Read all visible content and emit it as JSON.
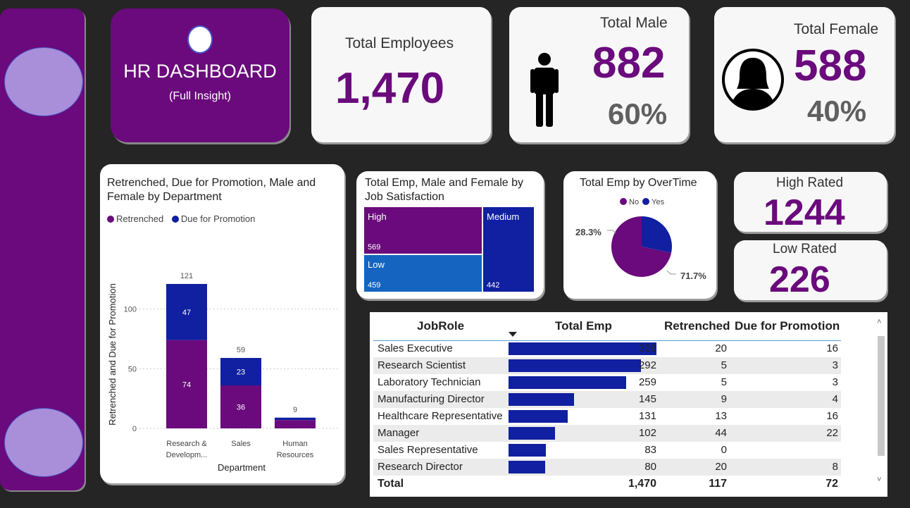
{
  "dashboard": {
    "title": "HR DASHBOARD",
    "subtitle": "(Full Insight)"
  },
  "kpi": {
    "total_employees": {
      "label": "Total Employees",
      "value": "1,470"
    },
    "total_male": {
      "label": "Total Male",
      "value": "882",
      "percent": "60%"
    },
    "total_female": {
      "label": "Total Female",
      "value": "588",
      "percent": "40%"
    },
    "high_rated": {
      "label": "High Rated",
      "value": "1244"
    },
    "low_rated": {
      "label": "Low Rated",
      "value": "226"
    }
  },
  "colors": {
    "purple": "#6a0a7c",
    "navy": "#1020a0",
    "blue": "#1565c0",
    "background": "#252525"
  },
  "chart_data": [
    {
      "type": "bar",
      "stacked": true,
      "title": "Retrenched, Due for Promotion, Male and Female by Department",
      "xlabel": "Department",
      "ylabel": "Retrenched and Due for Promotion",
      "categories": [
        "Research & Developm...",
        "Sales",
        "Human Resources"
      ],
      "series": [
        {
          "name": "Retrenched",
          "values": [
            74,
            36,
            7
          ],
          "color": "#6a0a7c"
        },
        {
          "name": "Due for Promotion",
          "values": [
            47,
            23,
            2
          ],
          "color": "#1020a0"
        }
      ],
      "totals": [
        "121",
        "59",
        "9"
      ],
      "segment_labels": {
        "retrenched": [
          "74",
          "36",
          ""
        ],
        "promotion": [
          "47",
          "23",
          ""
        ]
      },
      "yticks": [
        "0",
        "50",
        "100"
      ],
      "ylim": [
        0,
        121
      ],
      "legend": "top-left"
    },
    {
      "type": "treemap",
      "title": "Total Emp, Male and Female by Job Satisfaction",
      "items": [
        {
          "name": "High",
          "value": "569",
          "color": "#6a0a7c"
        },
        {
          "name": "Medium",
          "value": "442",
          "color": "#1020a0"
        },
        {
          "name": "Low",
          "value": "459",
          "color": "#1565c0"
        }
      ]
    },
    {
      "type": "pie",
      "title": "Total Emp by OverTime",
      "legend": "top",
      "slices": [
        {
          "name": "No",
          "value": 71.7,
          "label": "71.7%",
          "color": "#6a0a7c"
        },
        {
          "name": "Yes",
          "value": 28.3,
          "label": "28.3%",
          "color": "#1020a0"
        }
      ]
    },
    {
      "type": "table",
      "columns": [
        "JobRole",
        "Total Emp",
        "Retrenched",
        "Due for Promotion"
      ],
      "rows": [
        [
          "Sales Executive",
          "326",
          "20",
          "16"
        ],
        [
          "Research Scientist",
          "292",
          "5",
          "3"
        ],
        [
          "Laboratory Technician",
          "259",
          "5",
          "3"
        ],
        [
          "Manufacturing Director",
          "145",
          "9",
          "4"
        ],
        [
          "Healthcare Representative",
          "131",
          "13",
          "16"
        ],
        [
          "Manager",
          "102",
          "44",
          "22"
        ],
        [
          "Sales Representative",
          "83",
          "0",
          ""
        ],
        [
          "Research Director",
          "80",
          "20",
          "8"
        ]
      ],
      "bar_values": [
        326,
        292,
        259,
        145,
        131,
        102,
        83,
        80
      ],
      "total": [
        "Total",
        "1,470",
        "117",
        "72"
      ]
    }
  ],
  "scroll": {
    "up": "˄",
    "down": "˅"
  }
}
